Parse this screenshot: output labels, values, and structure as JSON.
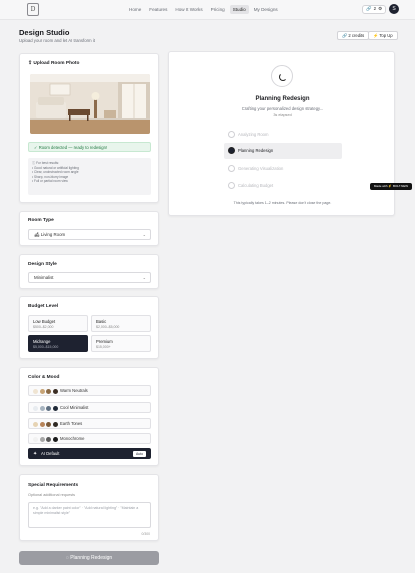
{
  "nav": {
    "logo": "D",
    "links": [
      "Home",
      "Features",
      "How It Works",
      "Pricing",
      "Studio",
      "My Designs"
    ],
    "active": "Studio",
    "credits": "2 credits",
    "avatar_initial": "S"
  },
  "header": {
    "title": "Design Studio",
    "subtitle": "Upload your room and let AI transform it",
    "credits_button": "2 credits",
    "topup_button": "Top Up"
  },
  "upload": {
    "title": "Upload Room Photo",
    "status": "Room detected — ready to redesign!",
    "tips_title": "For best results:",
    "tips": [
      "Good natural or artificial lighting",
      "Clear, unobstructed room angle",
      "Sharp, non-blurry image",
      "Full or partial room view"
    ]
  },
  "room_type": {
    "title": "Room Type",
    "value": "Living Room",
    "icon": "sofa-icon"
  },
  "design_style": {
    "title": "Design Style",
    "value": "Minimalist"
  },
  "budget": {
    "title": "Budget Level",
    "options": [
      {
        "name": "Low Budget",
        "range": "$500–$2,000"
      },
      {
        "name": "Basic",
        "range": "$2,000–$5,000"
      },
      {
        "name": "Midrange",
        "range": "$5,000–$15,000"
      },
      {
        "name": "Premium",
        "range": "$15,000+"
      }
    ],
    "selected": "Midrange"
  },
  "mood": {
    "title": "Color & Mood",
    "options": [
      {
        "name": "Warm Neutrals",
        "colors": [
          "#efe4d2",
          "#c7a476",
          "#8a6a45",
          "#3b2e24"
        ]
      },
      {
        "name": "Cool Minimalist",
        "colors": [
          "#e8ecf0",
          "#a7b4c0",
          "#5f7082",
          "#1f2937"
        ]
      },
      {
        "name": "Earth Tones",
        "colors": [
          "#e6d3b3",
          "#b8855a",
          "#7b5a3a",
          "#2f2a24"
        ]
      },
      {
        "name": "Monochrome",
        "colors": [
          "#f2f2f2",
          "#a8a8a8",
          "#5a5a5a",
          "#1a1a1a"
        ]
      }
    ],
    "ai_option": "AI Default",
    "ai_badge": "Auto"
  },
  "requirements": {
    "title": "Special Requirements",
    "hint": "Optional additional requests",
    "placeholder": "e.g. \"Add a darker paint color\" · \"Add natural lighting\" · \"Maintain a simple minimalist style\"",
    "counter": "0/300"
  },
  "cta": {
    "label": "Planning Redesign"
  },
  "progress": {
    "title": "Planning Redesign",
    "subtitle": "Crafting your personalized design strategy...",
    "elapsed": "3s elapsed",
    "steps": [
      "Analyzing Room",
      "Planning Redesign",
      "Generating Visualization",
      "Calculating Budget"
    ],
    "active_step": 1,
    "note": "This typically takes 1–2 minutes. Please don't close the page."
  },
  "badge": {
    "label": "Made with ⚡ BOLT.NEW"
  },
  "colors": {
    "accent": "#1e2230",
    "success_bg": "#e8f5ec",
    "success_text": "#237a43"
  }
}
